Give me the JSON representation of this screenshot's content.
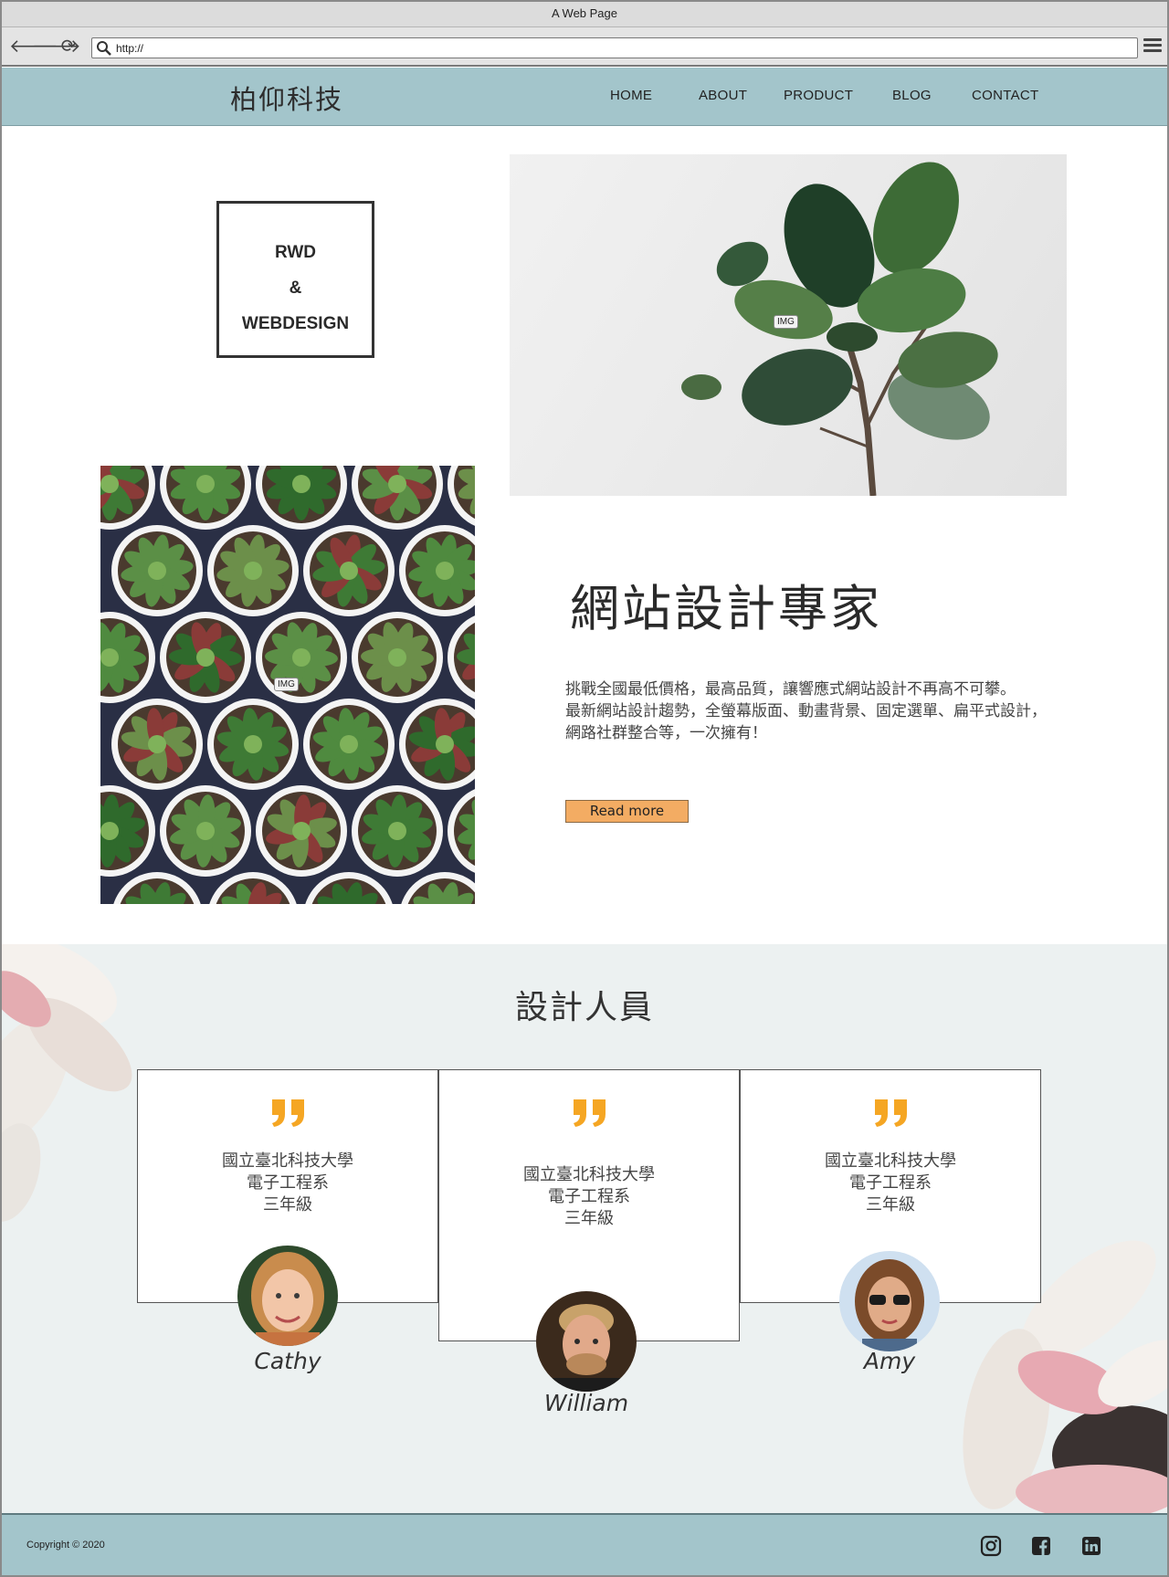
{
  "browser": {
    "title": "A Web Page",
    "url": "http://"
  },
  "header": {
    "logo": "柏仰科技",
    "nav": [
      "HOME",
      "ABOUT",
      "PRODUCT",
      "BLOG",
      "CONTACT"
    ]
  },
  "hero": {
    "badge": [
      "RWD",
      "&",
      "WEBDESIGN"
    ],
    "image_tag": "IMG",
    "title": "網站設計專家",
    "text": [
      "挑戰全國最低價格，最高品質，讓響應式網站設計不再高不可攀。",
      "最新網站設計趨勢，全螢幕版面、動畫背景、固定選單、扁平式設計，",
      "網路社群整合等，一次擁有！"
    ],
    "button": "Read more"
  },
  "team": {
    "title": "設計人員",
    "members": [
      {
        "lines": [
          "國立臺北科技大學",
          "電子工程系",
          "三年級"
        ],
        "name": "Cathy"
      },
      {
        "lines": [
          "國立臺北科技大學",
          "電子工程系",
          "三年級"
        ],
        "name": "William"
      },
      {
        "lines": [
          "國立臺北科技大學",
          "電子工程系",
          "三年級"
        ],
        "name": "Amy"
      }
    ]
  },
  "footer": {
    "copyright": "Copyright © 2020",
    "social_icons": [
      "instagram-icon",
      "facebook-icon",
      "linkedin-icon"
    ]
  },
  "colors": {
    "header_bg": "#a3c5cb",
    "button_bg": "#f3ac63",
    "quote": "#f5a623",
    "team_bg": "#ecf1f1"
  }
}
